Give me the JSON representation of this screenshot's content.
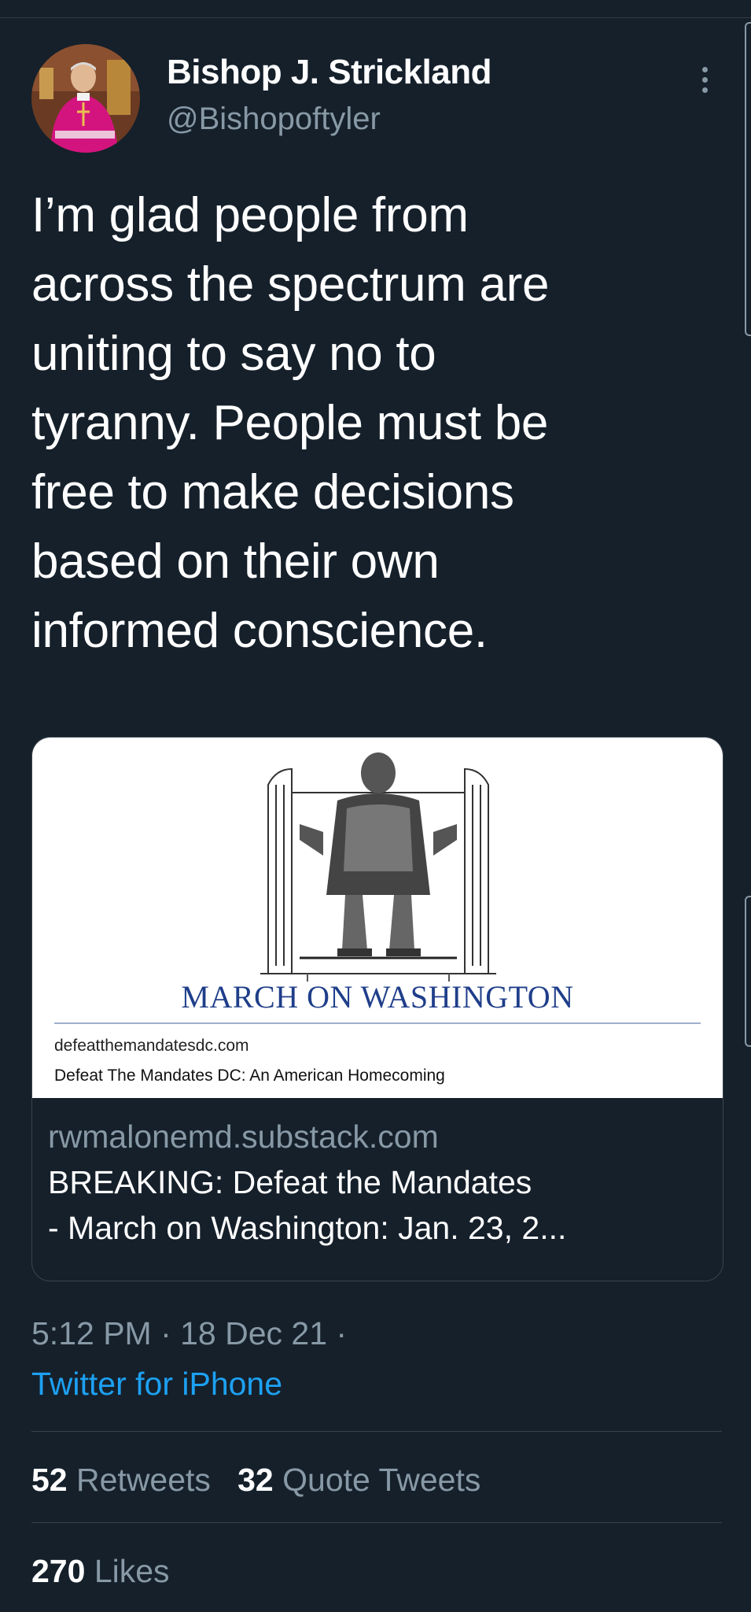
{
  "author": {
    "display_name": "Bishop J. Strickland",
    "handle": "@Bishopoftyler"
  },
  "tweet": {
    "text_lines": [
      "I’m glad people from",
      "across the spectrum are",
      "uniting to say no to",
      "tyranny. People must be",
      "free to make decisions",
      "based on their own",
      "informed conscience."
    ]
  },
  "card": {
    "image_heading": "MARCH ON WASHINGTON",
    "image_domain": "defeatthemandatesdc.com",
    "image_title": "Defeat The Mandates DC: An American Homecoming",
    "domain": "rwmalonemd.substack.com",
    "title_line_1": "BREAKING: Defeat the Mandates",
    "title_line_2": "- March on Washington: Jan. 23, 2..."
  },
  "meta": {
    "timestamp": "5:12 PM · 18 Dec 21 ·",
    "source": "Twitter for iPhone"
  },
  "stats": {
    "retweets_count": "52",
    "retweets_label": "Retweets",
    "quotes_count": "32",
    "quotes_label": "Quote Tweets",
    "likes_count": "270",
    "likes_label": "Likes"
  },
  "icons": {
    "more": "more-options-icon"
  },
  "colors": {
    "background": "#15202b",
    "secondary_text": "#8899a6",
    "link": "#1da1f2",
    "divider": "#38444d"
  }
}
